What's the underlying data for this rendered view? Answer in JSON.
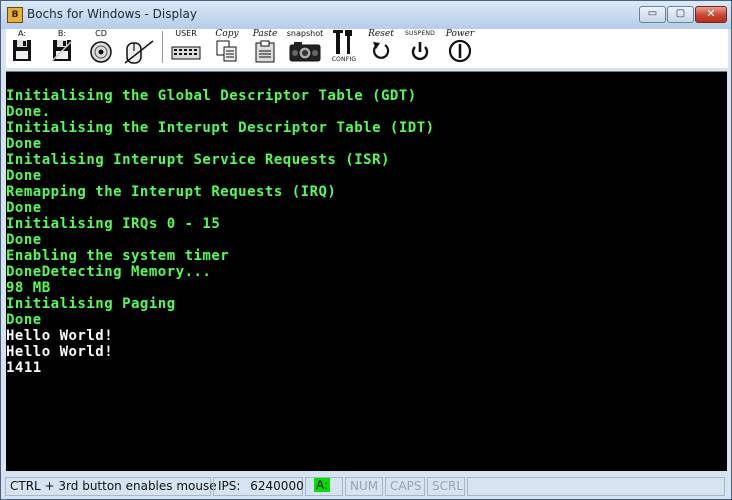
{
  "window": {
    "title": "Bochs for Windows - Display",
    "controls": {
      "minimize": "▭",
      "maximize": "▢",
      "close": "✕"
    }
  },
  "toolbar": {
    "floppy_a": "A:",
    "floppy_b": "B:",
    "cdrom": "CD",
    "user": "USER",
    "copy": "Copy",
    "paste": "Paste",
    "snapshot": "snapshot",
    "config": "CONFIG",
    "reset": "Reset",
    "suspend": "SUSPEND",
    "power": "Power"
  },
  "console": {
    "lines": [
      {
        "text": "Initialising the Global Descriptor Table (GDT)",
        "color": "green"
      },
      {
        "text": "Done.",
        "color": "green"
      },
      {
        "text": "Initialising the Interupt Descriptor Table (IDT)",
        "color": "green"
      },
      {
        "text": "Done",
        "color": "green"
      },
      {
        "text": "Initalising Interupt Service Requests (ISR)",
        "color": "green"
      },
      {
        "text": "Done",
        "color": "green"
      },
      {
        "text": "Remapping the Interupt Requests (IRQ)",
        "color": "green"
      },
      {
        "text": "Done",
        "color": "green"
      },
      {
        "text": "Initialising IRQs 0 - 15",
        "color": "green"
      },
      {
        "text": "Done",
        "color": "green"
      },
      {
        "text": "Enabling the system timer",
        "color": "green"
      },
      {
        "text": "DoneDetecting Memory...",
        "color": "green"
      },
      {
        "text": "98 MB",
        "color": "green"
      },
      {
        "text": "Initialising Paging",
        "color": "green"
      },
      {
        "text": "Done",
        "color": "green"
      },
      {
        "text": "Hello World!",
        "color": "white"
      },
      {
        "text": "Hello World!",
        "color": "white"
      },
      {
        "text": "1411",
        "color": "white"
      }
    ]
  },
  "statusbar": {
    "hint": "CTRL + 3rd button enables mouse",
    "ips_label": "IPS:",
    "ips_value": "6240000",
    "drive_led": "A:",
    "num": "NUM",
    "caps": "CAPS",
    "scrl": "SCRL"
  },
  "colors": {
    "console_green": "#54fc54",
    "console_white": "#fcfcfc",
    "console_bg": "#000000",
    "led_on": "#00e000"
  }
}
